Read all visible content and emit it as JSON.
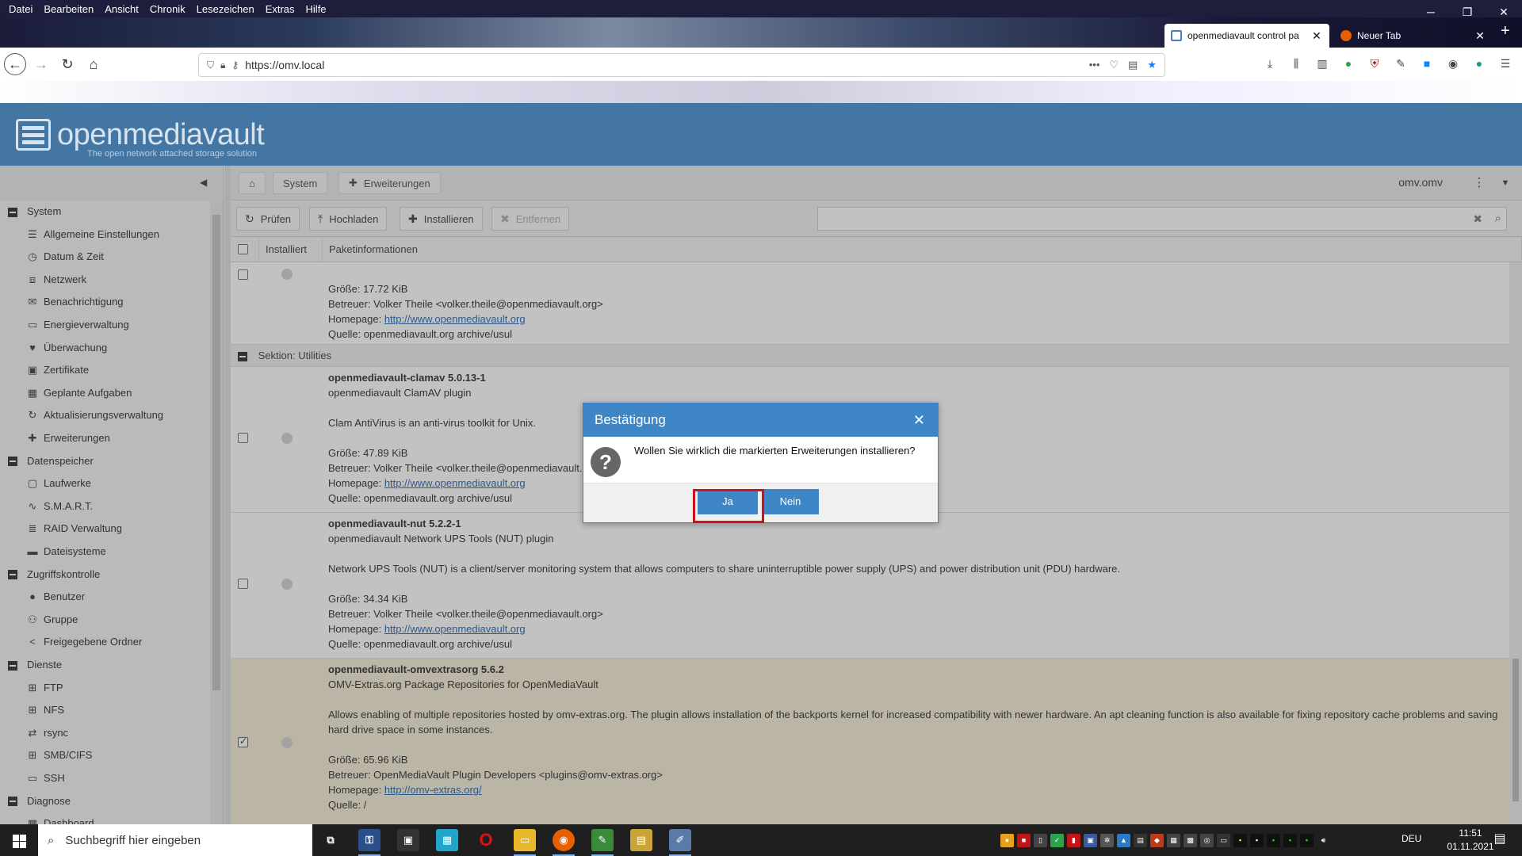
{
  "browser": {
    "menu": [
      "Datei",
      "Bearbeiten",
      "Ansicht",
      "Chronik",
      "Lesezeichen",
      "Extras",
      "Hilfe"
    ],
    "tabs": [
      {
        "label": "openmediavault control pa",
        "active": true
      },
      {
        "label": "Neuer Tab",
        "active": false
      }
    ],
    "url": "https://omv.local"
  },
  "omv": {
    "logo_text": "openmediavault",
    "logo_sub": "The open network attached storage solution",
    "breadcrumb": [
      "System",
      "Erweiterungen"
    ],
    "hostname": "omv.omv",
    "toolbar": {
      "check": "Prüfen",
      "upload": "Hochladen",
      "install": "Installieren",
      "remove": "Entfernen"
    },
    "columns": {
      "installed": "Installiert",
      "info": "Paketinformationen"
    },
    "tree": [
      {
        "type": "group",
        "label": "System"
      },
      {
        "type": "leaf",
        "label": "Allgemeine Einstellungen",
        "icon": "sliders-icon"
      },
      {
        "type": "leaf",
        "label": "Datum & Zeit",
        "icon": "clock-icon"
      },
      {
        "type": "leaf",
        "label": "Netzwerk",
        "icon": "network-icon"
      },
      {
        "type": "leaf",
        "label": "Benachrichtigung",
        "icon": "envelope-icon"
      },
      {
        "type": "leaf",
        "label": "Energieverwaltung",
        "icon": "battery-icon"
      },
      {
        "type": "leaf",
        "label": "Überwachung",
        "icon": "heartbeat-icon"
      },
      {
        "type": "leaf",
        "label": "Zertifikate",
        "icon": "certificate-icon"
      },
      {
        "type": "leaf",
        "label": "Geplante Aufgaben",
        "icon": "calendar-icon"
      },
      {
        "type": "leaf",
        "label": "Aktualisierungsverwaltung",
        "icon": "refresh-icon"
      },
      {
        "type": "leaf",
        "label": "Erweiterungen",
        "icon": "puzzle-icon"
      },
      {
        "type": "group",
        "label": "Datenspeicher"
      },
      {
        "type": "leaf",
        "label": "Laufwerke",
        "icon": "disk-icon"
      },
      {
        "type": "leaf",
        "label": "S.M.A.R.T.",
        "icon": "pulse-icon"
      },
      {
        "type": "leaf",
        "label": "RAID Verwaltung",
        "icon": "database-icon"
      },
      {
        "type": "leaf",
        "label": "Dateisysteme",
        "icon": "folder-icon"
      },
      {
        "type": "group",
        "label": "Zugriffskontrolle"
      },
      {
        "type": "leaf",
        "label": "Benutzer",
        "icon": "user-icon"
      },
      {
        "type": "leaf",
        "label": "Gruppe",
        "icon": "users-icon"
      },
      {
        "type": "leaf",
        "label": "Freigegebene Ordner",
        "icon": "share-icon"
      },
      {
        "type": "group",
        "label": "Dienste"
      },
      {
        "type": "leaf",
        "label": "FTP",
        "icon": "ftp-icon"
      },
      {
        "type": "leaf",
        "label": "NFS",
        "icon": "nfs-icon"
      },
      {
        "type": "leaf",
        "label": "rsync",
        "icon": "rsync-icon"
      },
      {
        "type": "leaf",
        "label": "SMB/CIFS",
        "icon": "windows-icon"
      },
      {
        "type": "leaf",
        "label": "SSH",
        "icon": "terminal-icon"
      },
      {
        "type": "group",
        "label": "Diagnose"
      },
      {
        "type": "leaf",
        "label": "Dashboard",
        "icon": "dashboard-icon"
      }
    ],
    "partial_row": {
      "size": "Größe: 17.72 KiB",
      "maintainer": "Betreuer: Volker Theile <volker.theile@openmediavault.org>",
      "homepage_label": "Homepage: ",
      "homepage": "http://www.openmediavault.org",
      "source": "Quelle: openmediavault.org archive/usul"
    },
    "section": "Sektion: Utilities",
    "packages": [
      {
        "name": "openmediavault-clamav 5.0.13-1",
        "summary": "openmediavault ClamAV plugin",
        "description": "Clam AntiVirus is an anti-virus toolkit for Unix.",
        "size": "Größe: 47.89 KiB",
        "maintainer": "Betreuer: Volker Theile <volker.theile@openmediavault.org>",
        "homepage_label": "Homepage: ",
        "homepage": "http://www.openmediavault.org",
        "source": "Quelle: openmediavault.org archive/usul",
        "selected": false
      },
      {
        "name": "openmediavault-nut 5.2.2-1",
        "summary": "openmediavault Network UPS Tools (NUT) plugin",
        "description": "Network UPS Tools (NUT) is a client/server monitoring system that allows computers to share uninterruptible power supply (UPS) and power distribution unit (PDU) hardware.",
        "size": "Größe: 34.34 KiB",
        "maintainer": "Betreuer: Volker Theile <volker.theile@openmediavault.org>",
        "homepage_label": "Homepage: ",
        "homepage": "http://www.openmediavault.org",
        "source": "Quelle: openmediavault.org archive/usul",
        "selected": false
      },
      {
        "name": "openmediavault-omvextrasorg 5.6.2",
        "summary": "OMV-Extras.org Package Repositories for OpenMediaVault",
        "description": "Allows enabling of multiple repositories hosted by omv-extras.org. The plugin allows installation of the backports kernel for increased compatibility with newer hardware. An apt cleaning function is also available for fixing repository cache problems and saving hard drive space in some instances.",
        "size": "Größe: 65.96 KiB",
        "maintainer": "Betreuer: OpenMediaVault Plugin Developers <plugins@omv-extras.org>",
        "homepage_label": "Homepage: ",
        "homepage": "http://omv-extras.org/",
        "source": "Quelle: /",
        "selected": true
      }
    ]
  },
  "dialog": {
    "title": "Bestätigung",
    "message": "Wollen Sie wirklich die markierten Erweiterungen installieren?",
    "yes": "Ja",
    "no": "Nein"
  },
  "taskbar": {
    "search_placeholder": "Suchbegriff hier eingeben",
    "language": "DEU",
    "time": "11:51",
    "date": "01.11.2021"
  },
  "colors": {
    "omv_header": "#4476a4",
    "dialog_title": "#3e86c6",
    "highlight": "#d0101a",
    "selected_row": "#f4ecd3"
  }
}
